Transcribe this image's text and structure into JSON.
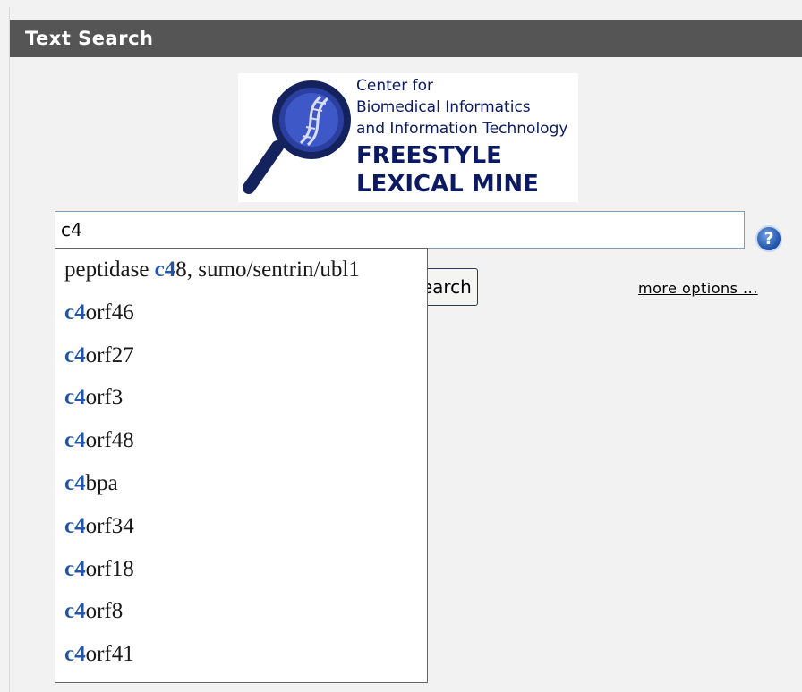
{
  "panel": {
    "title": "Text Search"
  },
  "logo": {
    "line1": "Center for",
    "line2": "Biomedical Informatics",
    "line3": "and Information Technology",
    "line4": "FREESTYLE",
    "line5": "LEXICAL MINE"
  },
  "search": {
    "value": "c4",
    "button_label": "Search"
  },
  "help_icon": {
    "glyph": "?",
    "icon": "question-icon"
  },
  "more_options": "more options ...",
  "suggestions": [
    {
      "before": "peptidase ",
      "match": "c4",
      "after": "8, sumo/sentrin/ubl1"
    },
    {
      "before": "",
      "match": "c4",
      "after": "orf46"
    },
    {
      "before": "",
      "match": "c4",
      "after": "orf27"
    },
    {
      "before": "",
      "match": "c4",
      "after": "orf3"
    },
    {
      "before": "",
      "match": "c4",
      "after": "orf48"
    },
    {
      "before": "",
      "match": "c4",
      "after": "bpa"
    },
    {
      "before": "",
      "match": "c4",
      "after": "orf34"
    },
    {
      "before": "",
      "match": "c4",
      "after": "orf18"
    },
    {
      "before": "",
      "match": "c4",
      "after": "orf8"
    },
    {
      "before": "",
      "match": "c4",
      "after": "orf41"
    }
  ],
  "colors": {
    "header_bg": "#555555",
    "highlight": "#2255aa",
    "logo_navy": "#0b1a63"
  }
}
